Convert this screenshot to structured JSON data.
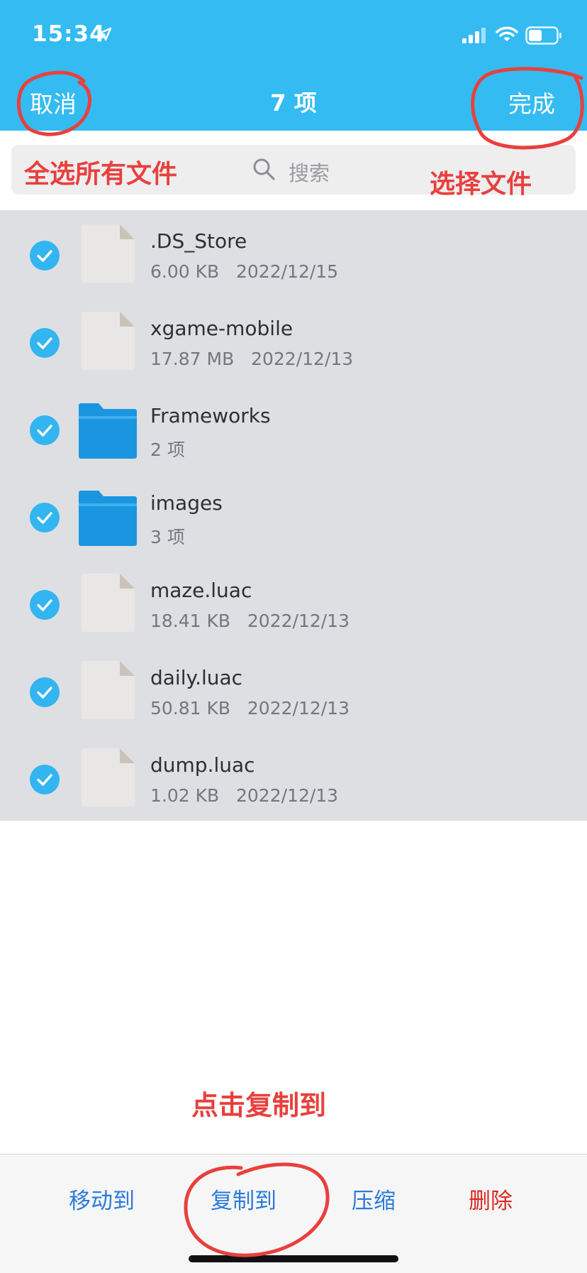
{
  "status_bar": {
    "time": "15:34"
  },
  "nav": {
    "cancel_label": "取消",
    "title": "7 项",
    "done_label": "完成"
  },
  "search": {
    "placeholder": "搜索"
  },
  "items": [
    {
      "name": ".DS_Store",
      "size": "6.00 KB",
      "date": "2022/12/15",
      "type": "file",
      "selected": true
    },
    {
      "name": "xgame-mobile",
      "size": "17.87 MB",
      "date": "2022/12/13",
      "type": "file",
      "selected": true
    },
    {
      "name": "Frameworks",
      "size": "2 项",
      "date": "",
      "type": "folder",
      "selected": true
    },
    {
      "name": "images",
      "size": "3 项",
      "date": "",
      "type": "folder",
      "selected": true
    },
    {
      "name": "maze.luac",
      "size": "18.41 KB",
      "date": "2022/12/13",
      "type": "file",
      "selected": true
    },
    {
      "name": "daily.luac",
      "size": "50.81 KB",
      "date": "2022/12/13",
      "type": "file",
      "selected": true
    },
    {
      "name": "dump.luac",
      "size": "1.02 KB",
      "date": "2022/12/13",
      "type": "file",
      "selected": true
    }
  ],
  "annotations": {
    "select_all": "全选所有文件",
    "select_file": "选择文件",
    "tap_copy": "点击复制到"
  },
  "toolbar": {
    "move_label": "移动到",
    "copy_label": "复制到",
    "compress_label": "压缩",
    "delete_label": "删除"
  },
  "colors": {
    "header": "#34bbf1",
    "accent": "#2b7bd9",
    "delete": "#d92a22",
    "annotation": "#e8403d",
    "check": "#32b5f0",
    "folder": "#1a96e0"
  }
}
